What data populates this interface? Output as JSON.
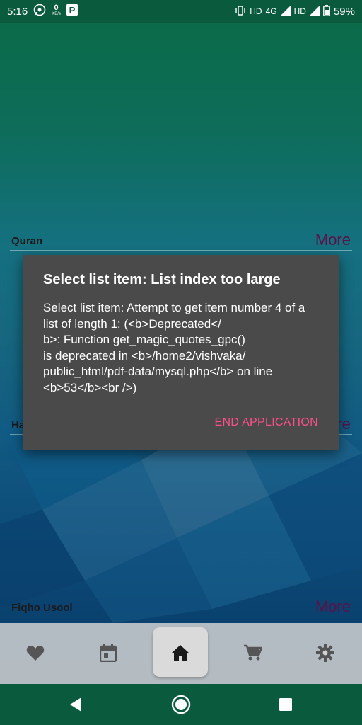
{
  "status_bar": {
    "time": "5:16",
    "speed_value": "0",
    "speed_unit": "KB/s",
    "network_hd_1": "HD",
    "network_4g": "4G",
    "network_hd_2": "HD",
    "battery": "59%"
  },
  "sections": [
    {
      "title": "Quran",
      "more": "More"
    },
    {
      "title": "Ha",
      "more": "re"
    },
    {
      "title": "Fiqho Usool",
      "more": "More"
    }
  ],
  "dialog": {
    "title": "Select list item: List index too large",
    "message": "Select list item: Attempt to get item number 4 of a list of length 1: (<b>Deprecated</\nb>:  Function get_magic_quotes_gpc()\nis deprecated in <b>/home2/vishvaka/\npublic_html/pdf-data/mysql.php</b> on line\n<b>53</b><br />)",
    "button": "END APPLICATION"
  },
  "bottom_nav": {
    "items": [
      {
        "icon": "heart-icon"
      },
      {
        "icon": "calendar-icon"
      },
      {
        "icon": "home-icon",
        "active": true
      },
      {
        "icon": "cart-icon"
      },
      {
        "icon": "gear-icon"
      }
    ]
  },
  "colors": {
    "accent": "#ff4f8b",
    "dialog_bg": "#4a4a4a",
    "status_bar": "#0a5a3e"
  }
}
